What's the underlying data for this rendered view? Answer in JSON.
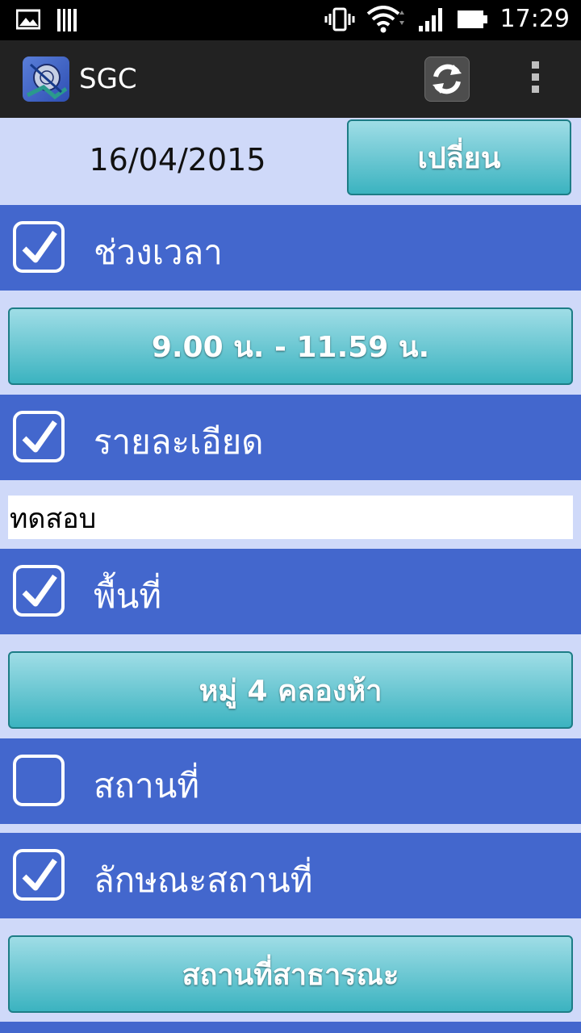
{
  "status_bar": {
    "time": "17:29",
    "icons": [
      "image-notification-icon",
      "barcode-notification-icon",
      "vibrate-icon",
      "wifi-icon",
      "signal-icon",
      "battery-icon"
    ]
  },
  "action_bar": {
    "title": "SGC",
    "icons": [
      "app-logo-icon",
      "refresh-icon",
      "overflow-menu-icon"
    ]
  },
  "date_row": {
    "date": "16/04/2015",
    "change_label": "เปลี่ยน"
  },
  "sections": [
    {
      "label": "ช่วงเวลา",
      "checked": true
    },
    {
      "label": "รายละเอียด",
      "checked": true
    },
    {
      "label": "พื้นที่",
      "checked": true
    },
    {
      "label": "สถานที่",
      "checked": false
    },
    {
      "label": "ลักษณะสถานที่",
      "checked": true
    }
  ],
  "time_range_button": "9.00 น.  -  11.59 น.",
  "detail_field_value": "ทดสอบ",
  "area_button": "หมู่ 4 คลองห้า",
  "place_type_button": "สถานที่สาธารณะ",
  "colors": {
    "section_bg": "#4367cd",
    "page_bg": "#cfd9f9",
    "button_top": "#9fdde6",
    "button_bottom": "#3bb3c0",
    "action_bar": "#222222"
  }
}
